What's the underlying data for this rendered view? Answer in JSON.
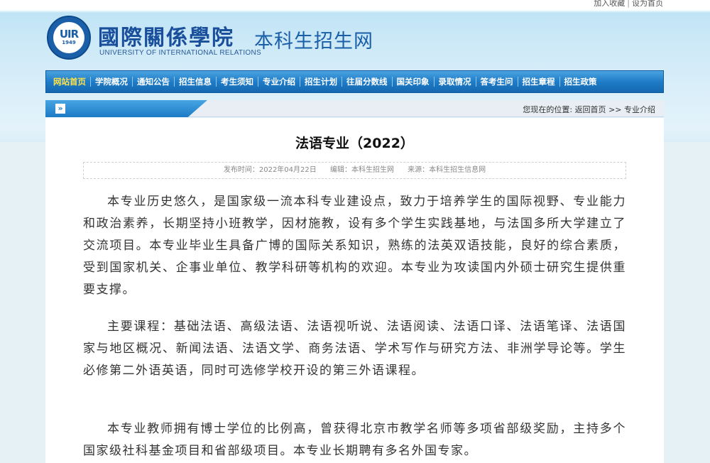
{
  "top_links": {
    "favorite": "加入收藏",
    "homepage": "设为首页"
  },
  "logo": {
    "monogram": "UIR",
    "year": "1949"
  },
  "school": {
    "name_cn": "國際關係學院",
    "name_en": "UNIVERSITY OF INTERNATIONAL RELATIONS"
  },
  "site": {
    "name": "本科生招生网"
  },
  "nav": {
    "items": [
      {
        "label": "网站首页"
      },
      {
        "label": "学院概况"
      },
      {
        "label": "通知公告"
      },
      {
        "label": "招生信息"
      },
      {
        "label": "考生须知"
      },
      {
        "label": "专业介绍"
      },
      {
        "label": "招生计划"
      },
      {
        "label": "往届分数线"
      },
      {
        "label": "国关印象"
      },
      {
        "label": "录取情况"
      },
      {
        "label": "答考生问"
      },
      {
        "label": "招生章程"
      },
      {
        "label": "招生政策"
      }
    ]
  },
  "breadcrumb": {
    "label": "您现在的位置:",
    "home": "返回首页",
    "sep": ">>",
    "current": "专业介绍"
  },
  "article": {
    "title": "法语专业（2022）",
    "date": "发布时间：2022年04月22日",
    "editor": "编辑：本科生招生网",
    "source": "来源：本科生招生信息网",
    "paragraphs": [
      "本专业历史悠久，是国家级一流本科专业建设点，致力于培养学生的国际视野、专业能力和政治素养，长期坚持小班教学，因材施教，设有多个学生实践基地，与法国多所大学建立了交流项目。本专业毕业生具备广博的国际关系知识，熟练的法英双语技能，良好的综合素质，受到国家机关、企事业单位、教学科研等机构的欢迎。本专业为攻读国内外硕士研究生提供重要支撑。",
      "主要课程：基础法语、高级法语、法语视听说、法语阅读、法语口译、法语笔译、法语国家与地区概况、新闻法语、法语文学、商务法语、学术写作与研究方法、非洲学导论等。学生必修第二外语英语，同时可选修学校开设的第三外语课程。",
      "本专业教师拥有博士学位的比例高，曾获得北京市教学名师等多项省部级奖励，主持多个国家级社科基金项目和省部级项目。本专业长期聘有多名外国专家。"
    ]
  },
  "colors": {
    "nav_blue": "#1f7cc7",
    "nav_active": "#ffe24a",
    "brand_blue": "#1a5fa8"
  }
}
